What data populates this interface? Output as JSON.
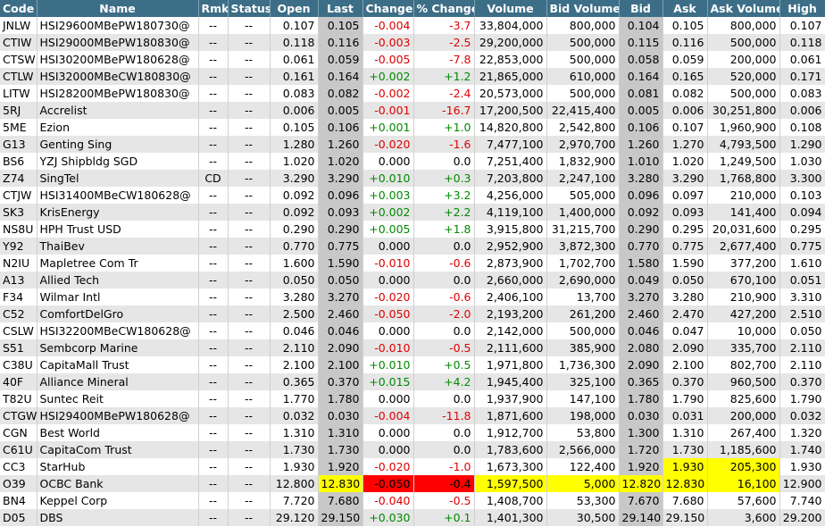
{
  "columns": [
    "Code",
    "Name",
    "Rmk",
    "Status",
    "Open",
    "Last",
    "Change",
    "% Change",
    "Volume",
    "Bid Volume",
    "Bid",
    "Ask",
    "Ask Volume",
    "High"
  ],
  "colors": {
    "header_bg": "#3d6e87",
    "positive": "#008a00",
    "negative": "#e00000",
    "highlight_yellow": "#ffff00",
    "highlight_red": "#ff0000"
  },
  "rows": [
    {
      "code": "JNLW",
      "name": "HSI29600MBePW180730@",
      "rmk": "--",
      "status": "--",
      "open": "0.107",
      "last": "0.105",
      "change": "-0.004",
      "pct": "-3.7",
      "volume": "33,804,000",
      "bid_vol": "800,000",
      "bid": "0.104",
      "ask": "0.105",
      "ask_vol": "800,000",
      "high": "0.107",
      "dir": "neg"
    },
    {
      "code": "CTIW",
      "name": "HSI29000MBePW180830@",
      "rmk": "--",
      "status": "--",
      "open": "0.118",
      "last": "0.116",
      "change": "-0.003",
      "pct": "-2.5",
      "volume": "29,200,000",
      "bid_vol": "500,000",
      "bid": "0.115",
      "ask": "0.116",
      "ask_vol": "500,000",
      "high": "0.118",
      "dir": "neg"
    },
    {
      "code": "CTSW",
      "name": "HSI30200MBePW180628@",
      "rmk": "--",
      "status": "--",
      "open": "0.061",
      "last": "0.059",
      "change": "-0.005",
      "pct": "-7.8",
      "volume": "22,853,000",
      "bid_vol": "500,000",
      "bid": "0.058",
      "ask": "0.059",
      "ask_vol": "200,000",
      "high": "0.061",
      "dir": "neg"
    },
    {
      "code": "CTLW",
      "name": "HSI32000MBeCW180830@",
      "rmk": "--",
      "status": "--",
      "open": "0.161",
      "last": "0.164",
      "change": "+0.002",
      "pct": "+1.2",
      "volume": "21,865,000",
      "bid_vol": "610,000",
      "bid": "0.164",
      "ask": "0.165",
      "ask_vol": "520,000",
      "high": "0.171",
      "dir": "pos"
    },
    {
      "code": "LITW",
      "name": "HSI28200MBePW180830@",
      "rmk": "--",
      "status": "--",
      "open": "0.083",
      "last": "0.082",
      "change": "-0.002",
      "pct": "-2.4",
      "volume": "20,573,000",
      "bid_vol": "500,000",
      "bid": "0.081",
      "ask": "0.082",
      "ask_vol": "500,000",
      "high": "0.083",
      "dir": "neg"
    },
    {
      "code": "5RJ",
      "name": "Accrelist",
      "rmk": "--",
      "status": "--",
      "open": "0.006",
      "last": "0.005",
      "change": "-0.001",
      "pct": "-16.7",
      "volume": "17,200,500",
      "bid_vol": "22,415,400",
      "bid": "0.005",
      "ask": "0.006",
      "ask_vol": "30,251,800",
      "high": "0.006",
      "dir": "neg"
    },
    {
      "code": "5ME",
      "name": "Ezion",
      "rmk": "--",
      "status": "--",
      "open": "0.105",
      "last": "0.106",
      "change": "+0.001",
      "pct": "+1.0",
      "volume": "14,820,800",
      "bid_vol": "2,542,800",
      "bid": "0.106",
      "ask": "0.107",
      "ask_vol": "1,960,900",
      "high": "0.108",
      "dir": "pos"
    },
    {
      "code": "G13",
      "name": "Genting Sing",
      "rmk": "--",
      "status": "--",
      "open": "1.280",
      "last": "1.260",
      "change": "-0.020",
      "pct": "-1.6",
      "volume": "7,477,100",
      "bid_vol": "2,970,700",
      "bid": "1.260",
      "ask": "1.270",
      "ask_vol": "4,793,500",
      "high": "1.290",
      "dir": "neg"
    },
    {
      "code": "BS6",
      "name": "YZJ Shipbldg SGD",
      "rmk": "--",
      "status": "--",
      "open": "1.020",
      "last": "1.020",
      "change": "0.000",
      "pct": "0.0",
      "volume": "7,251,400",
      "bid_vol": "1,832,900",
      "bid": "1.010",
      "ask": "1.020",
      "ask_vol": "1,249,500",
      "high": "1.030",
      "dir": "zero"
    },
    {
      "code": "Z74",
      "name": "SingTel",
      "rmk": "CD",
      "status": "--",
      "open": "3.290",
      "last": "3.290",
      "change": "+0.010",
      "pct": "+0.3",
      "volume": "7,203,800",
      "bid_vol": "2,247,100",
      "bid": "3.280",
      "ask": "3.290",
      "ask_vol": "1,768,800",
      "high": "3.300",
      "dir": "pos"
    },
    {
      "code": "CTJW",
      "name": "HSI31400MBeCW180628@",
      "rmk": "--",
      "status": "--",
      "open": "0.092",
      "last": "0.096",
      "change": "+0.003",
      "pct": "+3.2",
      "volume": "4,256,000",
      "bid_vol": "505,000",
      "bid": "0.096",
      "ask": "0.097",
      "ask_vol": "210,000",
      "high": "0.103",
      "dir": "pos"
    },
    {
      "code": "SK3",
      "name": "KrisEnergy",
      "rmk": "--",
      "status": "--",
      "open": "0.092",
      "last": "0.093",
      "change": "+0.002",
      "pct": "+2.2",
      "volume": "4,119,100",
      "bid_vol": "1,400,000",
      "bid": "0.092",
      "ask": "0.093",
      "ask_vol": "141,400",
      "high": "0.094",
      "dir": "pos"
    },
    {
      "code": "NS8U",
      "name": "HPH Trust USD",
      "rmk": "--",
      "status": "--",
      "open": "0.290",
      "last": "0.290",
      "change": "+0.005",
      "pct": "+1.8",
      "volume": "3,915,800",
      "bid_vol": "31,215,700",
      "bid": "0.290",
      "ask": "0.295",
      "ask_vol": "20,031,600",
      "high": "0.295",
      "dir": "pos"
    },
    {
      "code": "Y92",
      "name": "ThaiBev",
      "rmk": "--",
      "status": "--",
      "open": "0.770",
      "last": "0.775",
      "change": "0.000",
      "pct": "0.0",
      "volume": "2,952,900",
      "bid_vol": "3,872,300",
      "bid": "0.770",
      "ask": "0.775",
      "ask_vol": "2,677,400",
      "high": "0.775",
      "dir": "zero"
    },
    {
      "code": "N2IU",
      "name": "Mapletree Com Tr",
      "rmk": "--",
      "status": "--",
      "open": "1.600",
      "last": "1.590",
      "change": "-0.010",
      "pct": "-0.6",
      "volume": "2,873,900",
      "bid_vol": "1,702,700",
      "bid": "1.580",
      "ask": "1.590",
      "ask_vol": "377,200",
      "high": "1.610",
      "dir": "neg"
    },
    {
      "code": "A13",
      "name": "Allied Tech",
      "rmk": "--",
      "status": "--",
      "open": "0.050",
      "last": "0.050",
      "change": "0.000",
      "pct": "0.0",
      "volume": "2,660,000",
      "bid_vol": "2,690,000",
      "bid": "0.049",
      "ask": "0.050",
      "ask_vol": "670,100",
      "high": "0.051",
      "dir": "zero"
    },
    {
      "code": "F34",
      "name": "Wilmar Intl",
      "rmk": "--",
      "status": "--",
      "open": "3.280",
      "last": "3.270",
      "change": "-0.020",
      "pct": "-0.6",
      "volume": "2,406,100",
      "bid_vol": "13,700",
      "bid": "3.270",
      "ask": "3.280",
      "ask_vol": "210,900",
      "high": "3.310",
      "dir": "neg"
    },
    {
      "code": "C52",
      "name": "ComfortDelGro",
      "rmk": "--",
      "status": "--",
      "open": "2.500",
      "last": "2.460",
      "change": "-0.050",
      "pct": "-2.0",
      "volume": "2,193,200",
      "bid_vol": "261,200",
      "bid": "2.460",
      "ask": "2.470",
      "ask_vol": "427,200",
      "high": "2.510",
      "dir": "neg"
    },
    {
      "code": "CSLW",
      "name": "HSI32200MBeCW180628@",
      "rmk": "--",
      "status": "--",
      "open": "0.046",
      "last": "0.046",
      "change": "0.000",
      "pct": "0.0",
      "volume": "2,142,000",
      "bid_vol": "500,000",
      "bid": "0.046",
      "ask": "0.047",
      "ask_vol": "10,000",
      "high": "0.050",
      "dir": "zero"
    },
    {
      "code": "S51",
      "name": "Sembcorp Marine",
      "rmk": "--",
      "status": "--",
      "open": "2.110",
      "last": "2.090",
      "change": "-0.010",
      "pct": "-0.5",
      "volume": "2,111,600",
      "bid_vol": "385,900",
      "bid": "2.080",
      "ask": "2.090",
      "ask_vol": "335,700",
      "high": "2.110",
      "dir": "neg"
    },
    {
      "code": "C38U",
      "name": "CapitaMall Trust",
      "rmk": "--",
      "status": "--",
      "open": "2.100",
      "last": "2.100",
      "change": "+0.010",
      "pct": "+0.5",
      "volume": "1,971,800",
      "bid_vol": "1,736,300",
      "bid": "2.090",
      "ask": "2.100",
      "ask_vol": "802,700",
      "high": "2.110",
      "dir": "pos"
    },
    {
      "code": "40F",
      "name": "Alliance Mineral",
      "rmk": "--",
      "status": "--",
      "open": "0.365",
      "last": "0.370",
      "change": "+0.015",
      "pct": "+4.2",
      "volume": "1,945,400",
      "bid_vol": "325,100",
      "bid": "0.365",
      "ask": "0.370",
      "ask_vol": "960,500",
      "high": "0.370",
      "dir": "pos"
    },
    {
      "code": "T82U",
      "name": "Suntec Reit",
      "rmk": "--",
      "status": "--",
      "open": "1.770",
      "last": "1.780",
      "change": "0.000",
      "pct": "0.0",
      "volume": "1,937,900",
      "bid_vol": "147,100",
      "bid": "1.780",
      "ask": "1.790",
      "ask_vol": "825,600",
      "high": "1.790",
      "dir": "zero"
    },
    {
      "code": "CTGW",
      "name": "HSI29400MBePW180628@",
      "rmk": "--",
      "status": "--",
      "open": "0.032",
      "last": "0.030",
      "change": "-0.004",
      "pct": "-11.8",
      "volume": "1,871,600",
      "bid_vol": "198,000",
      "bid": "0.030",
      "ask": "0.031",
      "ask_vol": "200,000",
      "high": "0.032",
      "dir": "neg"
    },
    {
      "code": "CGN",
      "name": "Best World",
      "rmk": "--",
      "status": "--",
      "open": "1.310",
      "last": "1.310",
      "change": "0.000",
      "pct": "0.0",
      "volume": "1,912,700",
      "bid_vol": "53,800",
      "bid": "1.300",
      "ask": "1.310",
      "ask_vol": "267,400",
      "high": "1.320",
      "dir": "zero"
    },
    {
      "code": "C61U",
      "name": "CapitaCom Trust",
      "rmk": "--",
      "status": "--",
      "open": "1.730",
      "last": "1.730",
      "change": "0.000",
      "pct": "0.0",
      "volume": "1,783,600",
      "bid_vol": "2,566,000",
      "bid": "1.720",
      "ask": "1.730",
      "ask_vol": "1,185,600",
      "high": "1.740",
      "dir": "zero"
    },
    {
      "code": "CC3",
      "name": "StarHub",
      "rmk": "--",
      "status": "--",
      "open": "1.930",
      "last": "1.920",
      "change": "-0.020",
      "pct": "-1.0",
      "volume": "1,673,300",
      "bid_vol": "122,400",
      "bid": "1.920",
      "ask": "1.930",
      "ask_vol": "205,300",
      "high": "1.930",
      "dir": "neg",
      "hl": [
        "ask",
        "ask_vol"
      ]
    },
    {
      "code": "O39",
      "name": "OCBC Bank",
      "rmk": "--",
      "status": "--",
      "open": "12.800",
      "last": "12.830",
      "change": "-0.050",
      "pct": "-0.4",
      "volume": "1,597,500",
      "bid_vol": "5,000",
      "bid": "12.820",
      "ask": "12.830",
      "ask_vol": "16,100",
      "high": "12.900",
      "dir": "neg",
      "hl": [
        "last",
        "volume",
        "bid_vol",
        "bid",
        "ask",
        "ask_vol"
      ],
      "hl_red": [
        "change",
        "pct"
      ]
    },
    {
      "code": "BN4",
      "name": "Keppel Corp",
      "rmk": "--",
      "status": "--",
      "open": "7.720",
      "last": "7.680",
      "change": "-0.040",
      "pct": "-0.5",
      "volume": "1,408,700",
      "bid_vol": "53,300",
      "bid": "7.670",
      "ask": "7.680",
      "ask_vol": "57,600",
      "high": "7.740",
      "dir": "neg"
    },
    {
      "code": "D05",
      "name": "DBS",
      "rmk": "--",
      "status": "--",
      "open": "29.120",
      "last": "29.150",
      "change": "+0.030",
      "pct": "+0.1",
      "volume": "1,401,300",
      "bid_vol": "30,500",
      "bid": "29.140",
      "ask": "29.150",
      "ask_vol": "3,600",
      "high": "29.200",
      "dir": "pos"
    }
  ]
}
